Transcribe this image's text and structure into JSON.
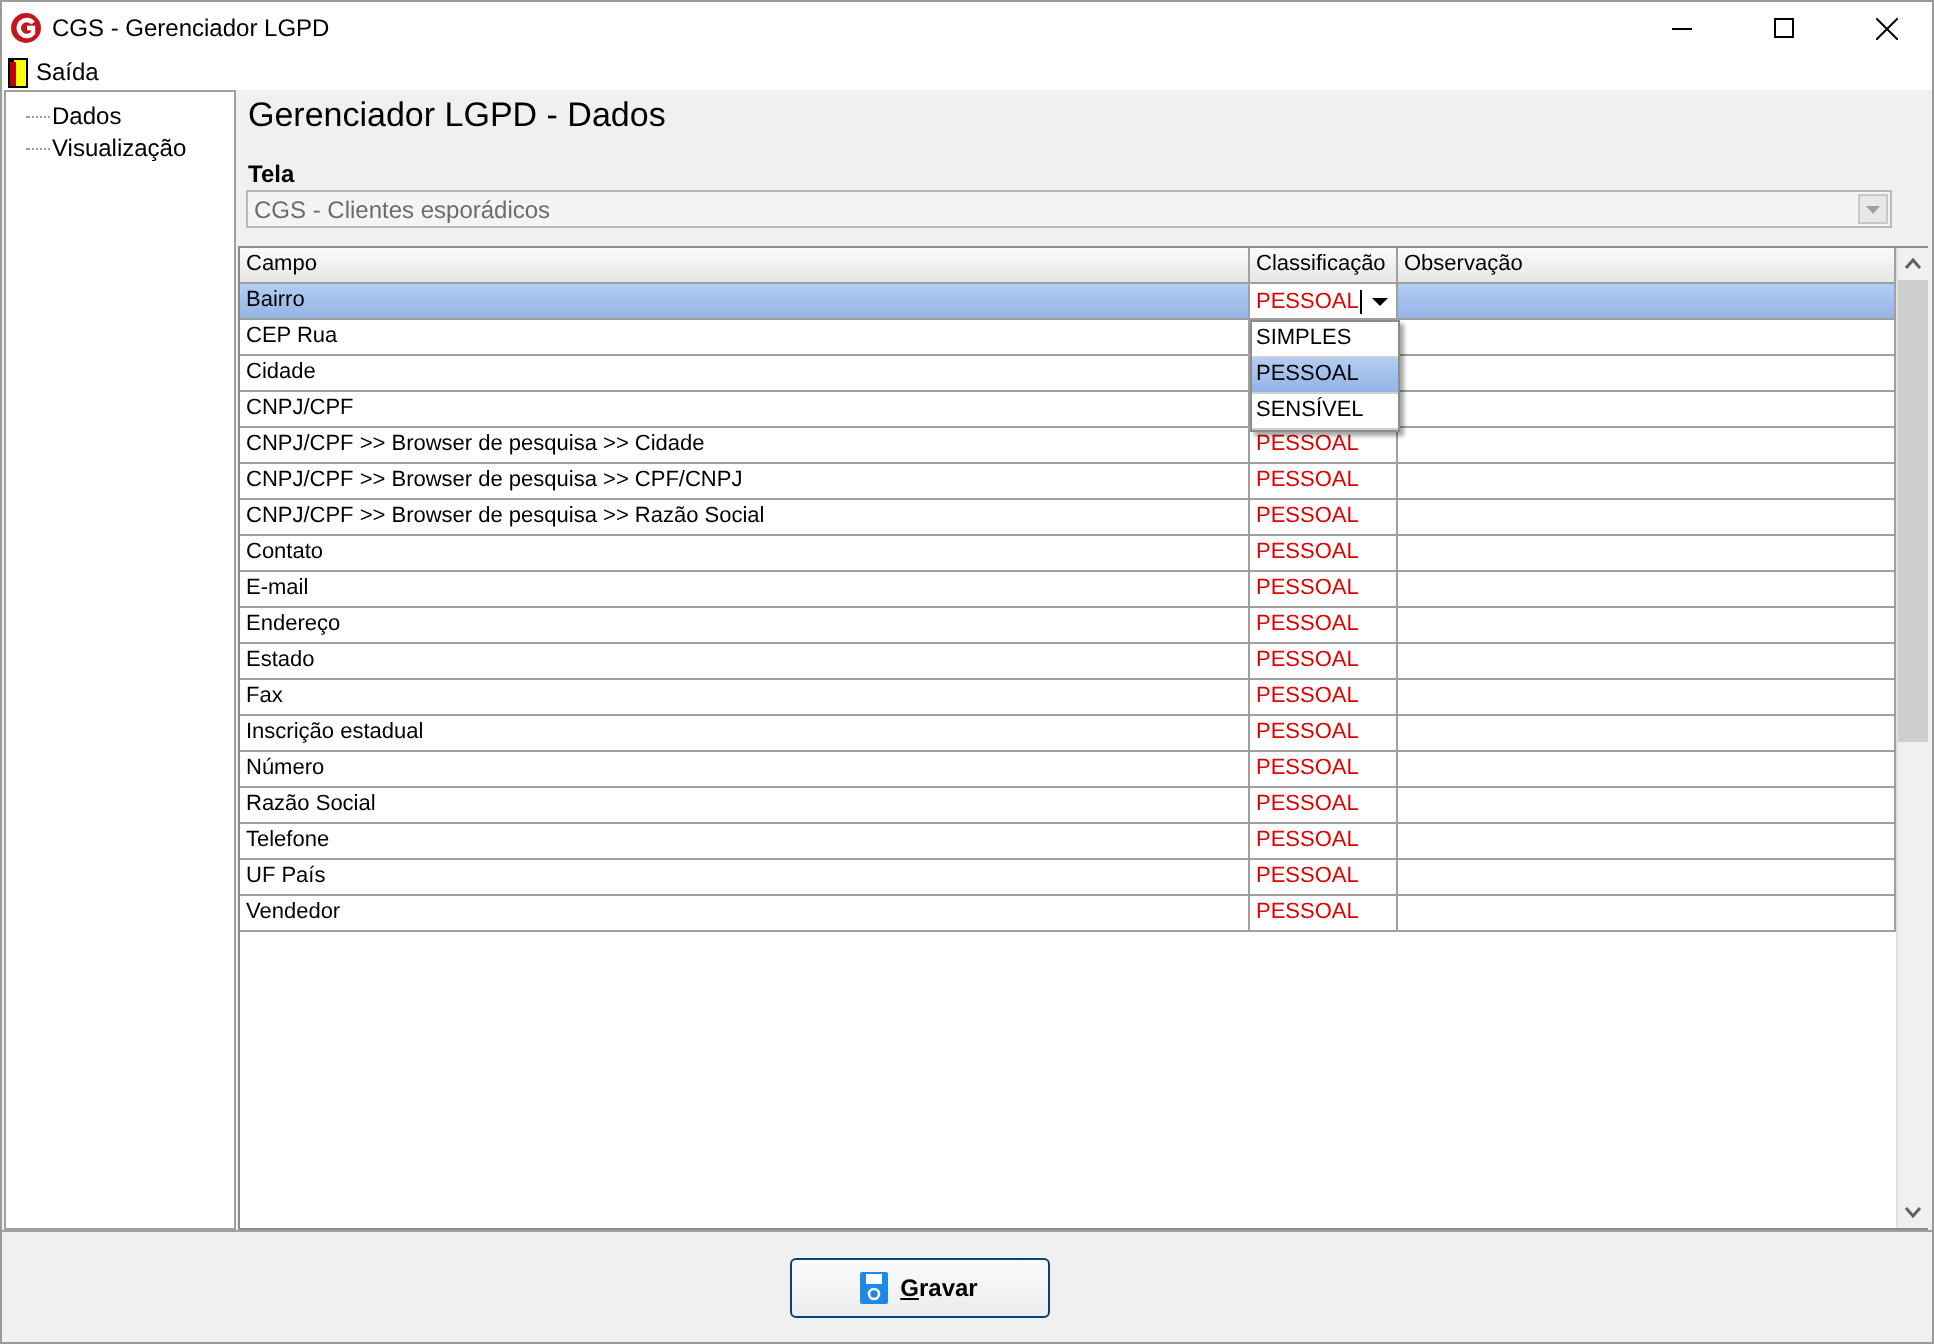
{
  "window": {
    "title": "CGS - Gerenciador LGPD"
  },
  "menu": [
    {
      "label": "Saída"
    }
  ],
  "tree": [
    {
      "label": "Dados"
    },
    {
      "label": "Visualização"
    }
  ],
  "heading": "Gerenciador LGPD - Dados",
  "screen_field": {
    "label": "Tela",
    "value": "CGS - Clientes esporádicos"
  },
  "table": {
    "columns": [
      "Campo",
      "Classificação",
      "Observação"
    ],
    "rows": [
      {
        "campo": "Bairro",
        "classificacao": "PESSOAL",
        "selected": true,
        "editing": true
      },
      {
        "campo": "CEP Rua",
        "selected": false,
        "editing": false
      },
      {
        "campo": "Cidade",
        "selected": false,
        "editing": false
      },
      {
        "campo": "CNPJ/CPF",
        "selected": false,
        "editing": false
      },
      {
        "campo": "CNPJ/CPF >> Browser de pesquisa >> Cidade",
        "classificacao": "PESSOAL",
        "selected": false,
        "editing": false
      },
      {
        "campo": "CNPJ/CPF >> Browser de pesquisa >> CPF/CNPJ",
        "classificacao": "PESSOAL",
        "selected": false,
        "editing": false
      },
      {
        "campo": "CNPJ/CPF >> Browser de pesquisa >> Razão Social",
        "classificacao": "PESSOAL",
        "selected": false,
        "editing": false
      },
      {
        "campo": "Contato",
        "classificacao": "PESSOAL",
        "selected": false,
        "editing": false
      },
      {
        "campo": "E-mail",
        "classificacao": "PESSOAL",
        "selected": false,
        "editing": false
      },
      {
        "campo": "Endereço",
        "classificacao": "PESSOAL",
        "selected": false,
        "editing": false
      },
      {
        "campo": "Estado",
        "classificacao": "PESSOAL",
        "selected": false,
        "editing": false
      },
      {
        "campo": "Fax",
        "classificacao": "PESSOAL",
        "selected": false,
        "editing": false
      },
      {
        "campo": "Inscrição estadual",
        "classificacao": "PESSOAL",
        "selected": false,
        "editing": false
      },
      {
        "campo": "Número",
        "classificacao": "PESSOAL",
        "selected": false,
        "editing": false
      },
      {
        "campo": "Razão Social",
        "classificacao": "PESSOAL",
        "selected": false,
        "editing": false
      },
      {
        "campo": "Telefone",
        "classificacao": "PESSOAL",
        "selected": false,
        "editing": false
      },
      {
        "campo": "UF País",
        "classificacao": "PESSOAL",
        "selected": false,
        "editing": false
      },
      {
        "campo": "Vendedor",
        "classificacao": "PESSOAL",
        "selected": false,
        "editing": false
      }
    ]
  },
  "dropdown": {
    "options": [
      {
        "label": "SIMPLES",
        "selected": false
      },
      {
        "label": "PESSOAL",
        "selected": true
      },
      {
        "label": "SENSÍVEL",
        "selected": false
      }
    ]
  },
  "buttons": [
    {
      "label": "Gravar"
    }
  ]
}
